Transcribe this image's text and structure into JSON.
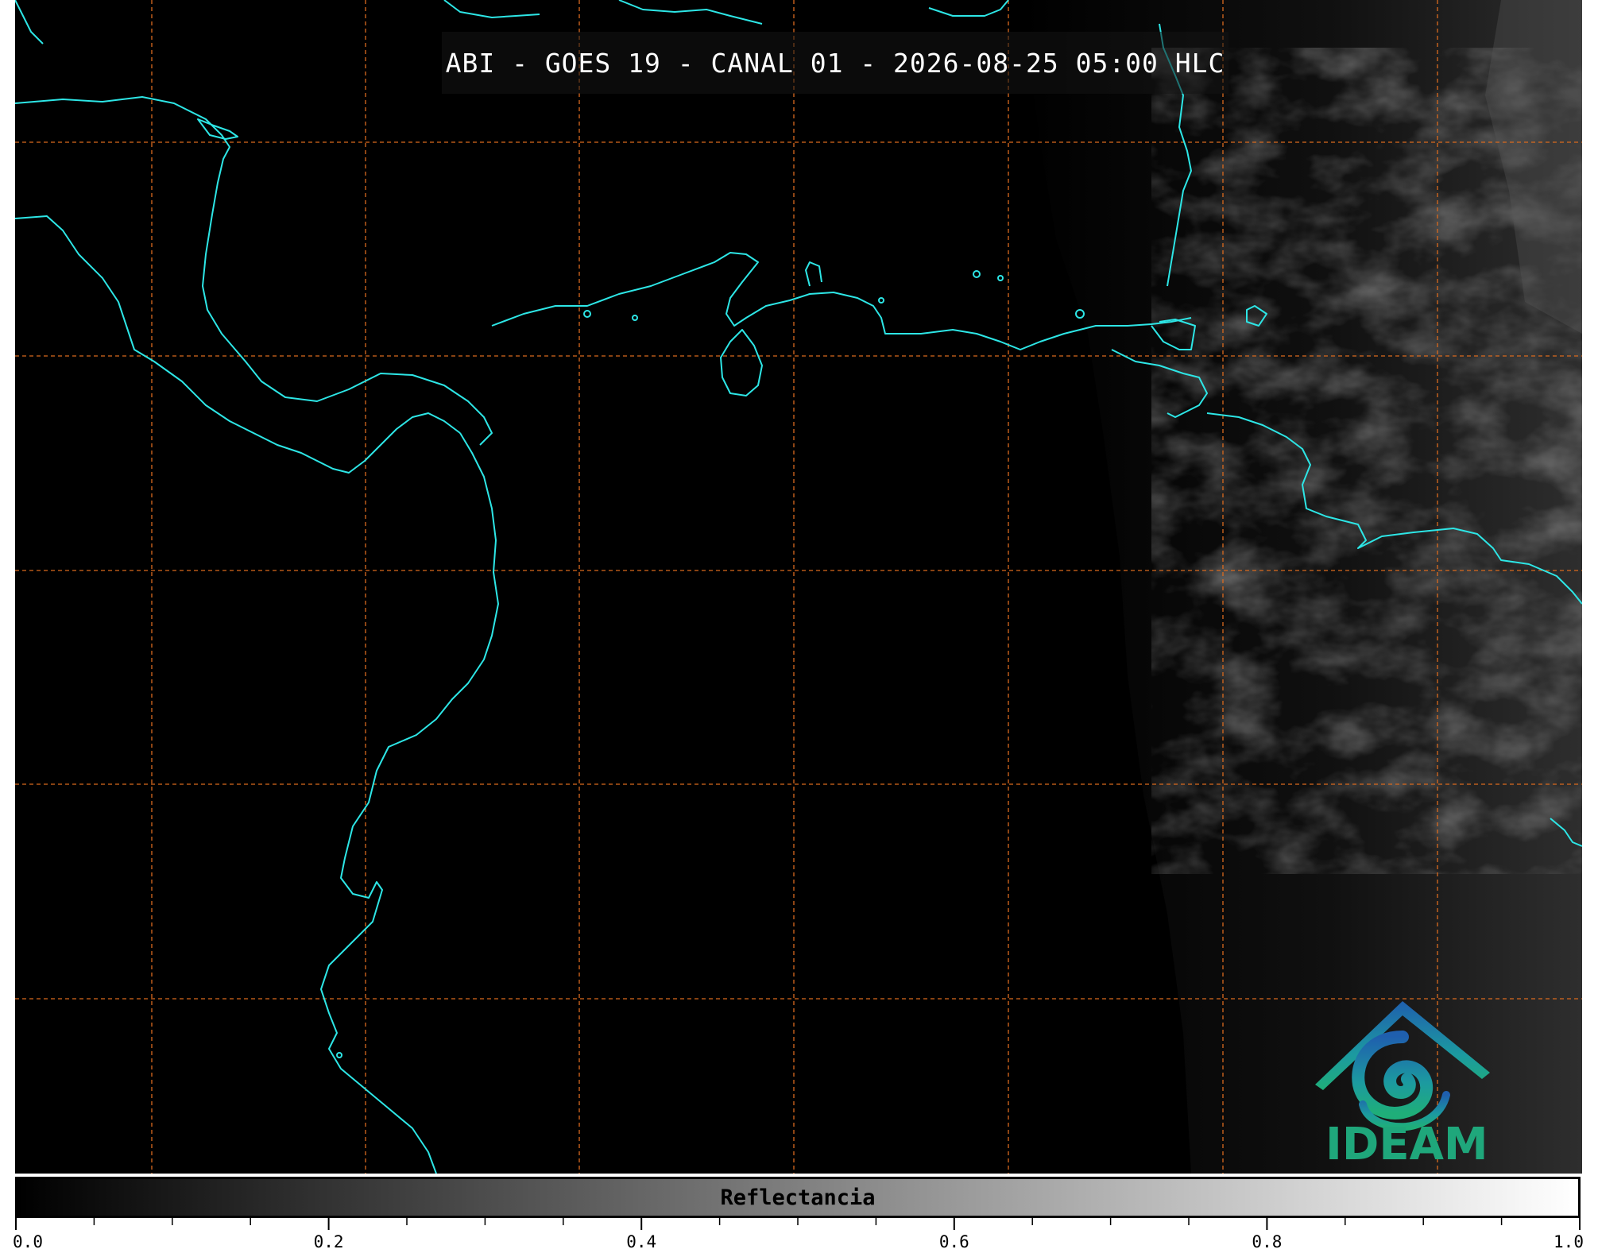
{
  "title": "ABI - GOES 19 - CANAL 01 - 2026-08-25 05:00 HLC",
  "logo": {
    "text": "IDEAM",
    "icon": "ideam-logo-icon"
  },
  "colorbar": {
    "label": "Reflectancia",
    "range": [
      0.0,
      1.0
    ],
    "ticks": [
      "0.0",
      "0.2",
      "0.4",
      "0.6",
      "0.8",
      "1.0"
    ],
    "minor_ticks_per_major": 4,
    "colormap": "grayscale"
  },
  "map": {
    "coastline_color": "#2de6e6",
    "gridline_color": "#d96a1e",
    "gridline_style": "dashed",
    "background": "#000000"
  }
}
